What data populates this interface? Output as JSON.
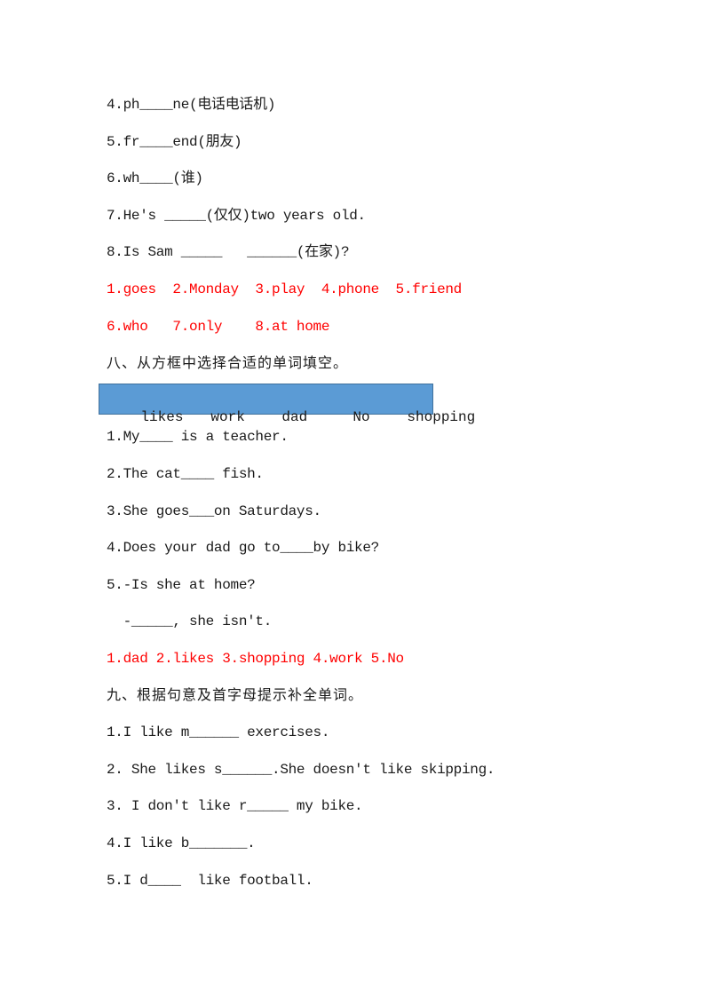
{
  "section7": {
    "items": [
      "4.ph____ne(电话电话机)",
      "5.fr____end(朋友)",
      "6.wh____(谁)",
      "7.He's _____(仅仅)two years old.",
      "8.Is Sam _____   ______(在家)?"
    ],
    "answers": [
      "1.goes  2.Monday  3.play  4.phone  5.friend",
      "6.who   7.only    8.at home"
    ]
  },
  "section8": {
    "heading": "八、从方框中选择合适的单词填空。",
    "word_box": [
      "likes",
      "work",
      "dad",
      "No",
      "shopping"
    ],
    "items": [
      "1.My____ is a teacher.",
      "2.The cat____ fish.",
      "3.She goes___on Saturdays.",
      "4.Does your dad go to____by bike?",
      "5.-Is she at home?",
      "  -_____, she isn't."
    ],
    "answers": "1.dad 2.likes 3.shopping 4.work 5.No"
  },
  "section9": {
    "heading": "九、根据句意及首字母提示补全单词。",
    "items": [
      "1.I like m______ exercises.",
      "2. She likes s______.She doesn't like skipping.",
      "3. I don't like r_____ my bike.",
      "4.I like b_______.",
      "5.I d____  like football."
    ]
  },
  "colors": {
    "answer_text": "#ff0000",
    "word_box_fill": "#5b9bd5"
  }
}
